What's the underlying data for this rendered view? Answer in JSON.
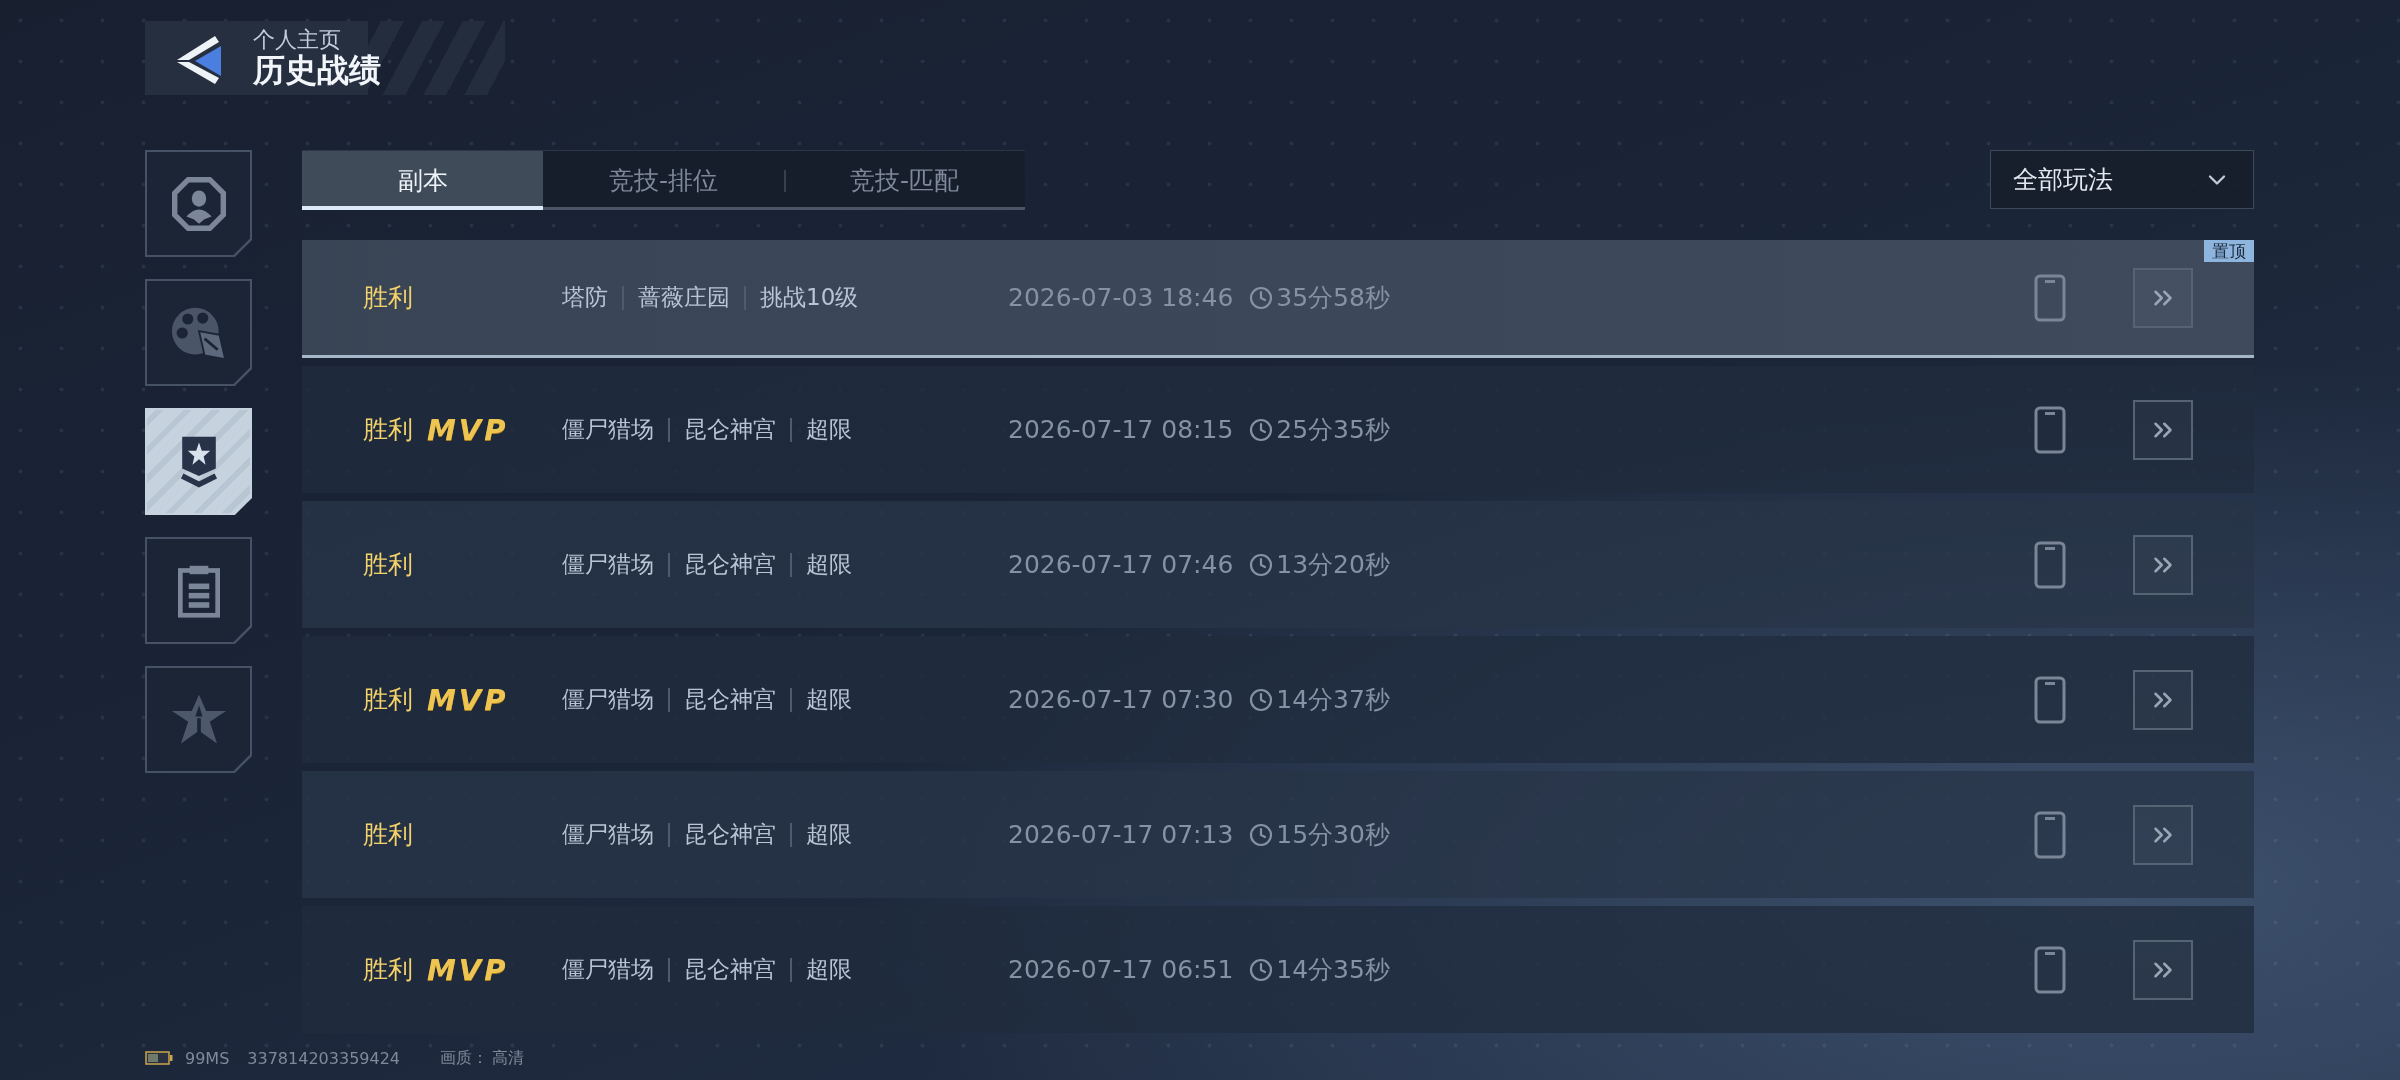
{
  "header": {
    "subtitle": "个人主页",
    "title": "历史战绩"
  },
  "sidebar": {
    "items": [
      {
        "kind": "profile",
        "selected": false
      },
      {
        "kind": "reel",
        "selected": false
      },
      {
        "kind": "rank",
        "selected": true
      },
      {
        "kind": "clipboard",
        "selected": false
      },
      {
        "kind": "emblem",
        "selected": false
      }
    ]
  },
  "tabs": [
    {
      "label": "副本",
      "selected": true
    },
    {
      "label": "竞技-排位",
      "selected": false
    },
    {
      "label": "竞技-匹配",
      "selected": false
    }
  ],
  "filter": {
    "label": "全部玩法"
  },
  "matches": [
    {
      "pinned": true,
      "badge": "置顶",
      "result": "胜利",
      "mode": [
        "塔防",
        "蔷薇庄园",
        "挑战10级"
      ],
      "date": "2026-07-03 18:46",
      "duration": "35分58秒"
    },
    {
      "pinned": false,
      "result": "胜利",
      "mvp": "MVP",
      "mode": [
        "僵尸猎场",
        "昆仑神宫",
        "超限"
      ],
      "date": "2026-07-17 08:15",
      "duration": "25分35秒"
    },
    {
      "pinned": false,
      "result": "胜利",
      "mode": [
        "僵尸猎场",
        "昆仑神宫",
        "超限"
      ],
      "date": "2026-07-17 07:46",
      "duration": "13分20秒"
    },
    {
      "pinned": false,
      "result": "胜利",
      "mvp": "MVP",
      "mode": [
        "僵尸猎场",
        "昆仑神宫",
        "超限"
      ],
      "date": "2026-07-17 07:30",
      "duration": "14分37秒"
    },
    {
      "pinned": false,
      "result": "胜利",
      "mode": [
        "僵尸猎场",
        "昆仑神宫",
        "超限"
      ],
      "date": "2026-07-17 07:13",
      "duration": "15分30秒"
    },
    {
      "pinned": false,
      "result": "胜利",
      "mvp": "MVP",
      "mode": [
        "僵尸猎场",
        "昆仑神宫",
        "超限"
      ],
      "date": "2026-07-17 06:51",
      "duration": "14分35秒"
    }
  ],
  "status_bar": {
    "ping": "99MS",
    "player_id": "337814203359424",
    "quality_label": "画质：",
    "quality_value": "高清"
  }
}
